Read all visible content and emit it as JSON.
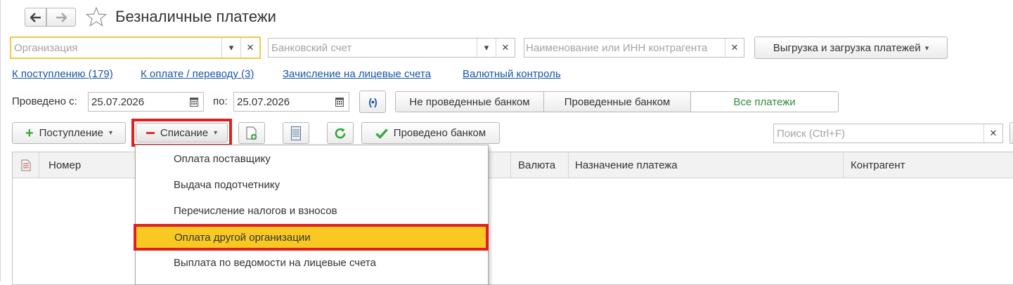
{
  "header": {
    "title": "Безналичные платежи",
    "back_icon": "arrow-left-icon",
    "forward_icon": "arrow-right-icon",
    "favorite_icon": "star-outline-icon"
  },
  "filters": {
    "organization_placeholder": "Организация",
    "bank_account_placeholder": "Банковский счет",
    "counterparty_placeholder": "Наименование или ИНН контрагента",
    "export_import_label": "Выгрузка и загрузка платежей"
  },
  "links": {
    "incoming": "К поступлению (179)",
    "to_pay": "К оплате / переводу (3)",
    "personal_accounts": "Зачисление на лицевые счета",
    "currency_control": "Валютный контроль"
  },
  "period": {
    "from_label": "Проведено с:",
    "from_value": "25.07.2026",
    "to_label": "по:",
    "to_value": "25.07.2026"
  },
  "status_tabs": {
    "not_posted": "Не проведенные банком",
    "posted": "Проведенные банком",
    "all": "Все платежи",
    "active_color": "#2e8b3a"
  },
  "toolbar": {
    "receipt_label": "Поступление",
    "writeoff_label": "Списание",
    "posted_by_bank_label": "Проведено банком",
    "search_placeholder": "Поиск (Ctrl+F)"
  },
  "table": {
    "columns": {
      "number": "Номер",
      "currency": "Валюта",
      "purpose": "Назначение платежа",
      "counterparty": "Контрагент"
    }
  },
  "dropdown": {
    "items": [
      "Оплата поставщику",
      "Выдача подотчетнику",
      "Перечисление налогов и взносов",
      "Оплата другой организации",
      "Выплата по ведомости на лицевые счета"
    ],
    "highlight_index": 3,
    "highlight_color": "#f9c923",
    "outline_color": "#e02020"
  }
}
